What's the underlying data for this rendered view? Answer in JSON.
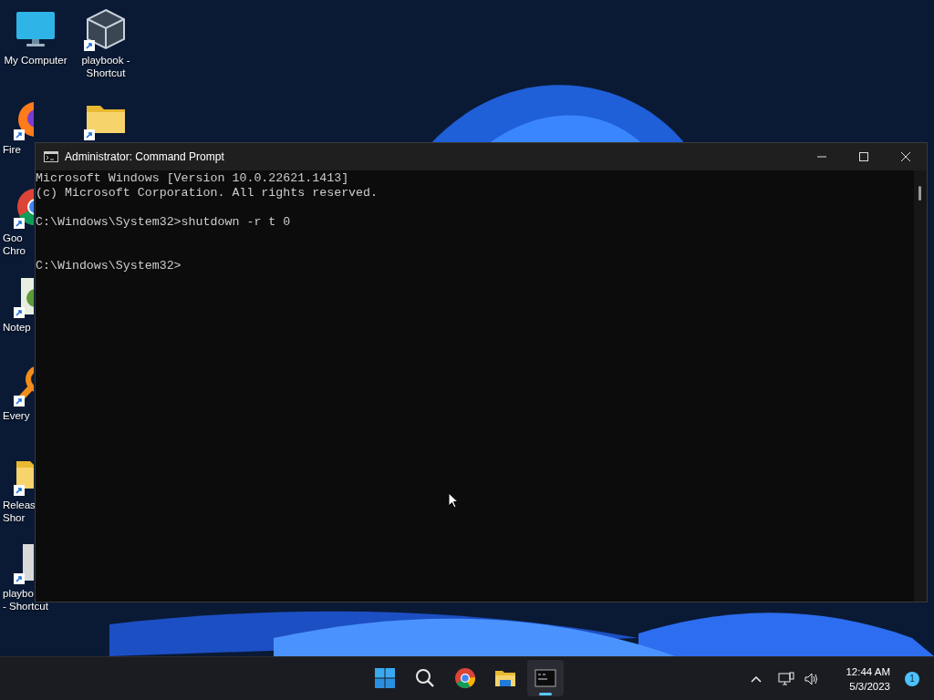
{
  "desktop_icons": [
    {
      "kind": "monitor",
      "shortcut": false,
      "cut": false,
      "label": [
        "My Computer"
      ]
    },
    {
      "kind": "cube",
      "shortcut": true,
      "cut": false,
      "label": [
        "playbook -",
        "Shortcut"
      ]
    },
    {
      "kind": "firefox",
      "shortcut": true,
      "cut": true,
      "label": [
        "Fire"
      ]
    },
    {
      "kind": "folder",
      "shortcut": true,
      "cut": false
    },
    {
      "kind": "chrome",
      "shortcut": true,
      "cut": true,
      "label": [
        "Goo",
        "Chro"
      ]
    },
    {
      "kind": "notepad",
      "shortcut": true,
      "cut": true,
      "label": [
        "Notep"
      ]
    },
    {
      "kind": "everything",
      "shortcut": true,
      "cut": true,
      "label": [
        "Every"
      ]
    },
    {
      "kind": "folder",
      "shortcut": true,
      "cut": true,
      "label": [
        "Releas",
        "Shor"
      ]
    },
    {
      "kind": "document",
      "shortcut": true,
      "cut": true,
      "label": [
        "playbo",
        "- Shortcut"
      ]
    }
  ],
  "window": {
    "title": "Administrator: Command Prompt",
    "console_lines": [
      {
        "kind": "output",
        "text": "Microsoft Windows [Version 10.0.22621.1413]"
      },
      {
        "kind": "output",
        "text": "(c) Microsoft Corporation. All rights reserved."
      },
      {
        "kind": "command",
        "text": "C:\\Windows\\System32>shutdown -r t 0"
      },
      {
        "kind": "prompt",
        "text": "C:\\Windows\\System32>"
      }
    ]
  },
  "taskbar": {
    "apps": [
      {
        "kind": "start",
        "active": false
      },
      {
        "kind": "search",
        "active": false
      },
      {
        "kind": "chrome",
        "active": false
      },
      {
        "kind": "explorer",
        "active": false
      },
      {
        "kind": "terminal",
        "active": true
      }
    ],
    "time": "12:44 AM",
    "date": "5/3/2023",
    "notification_count": "1"
  }
}
